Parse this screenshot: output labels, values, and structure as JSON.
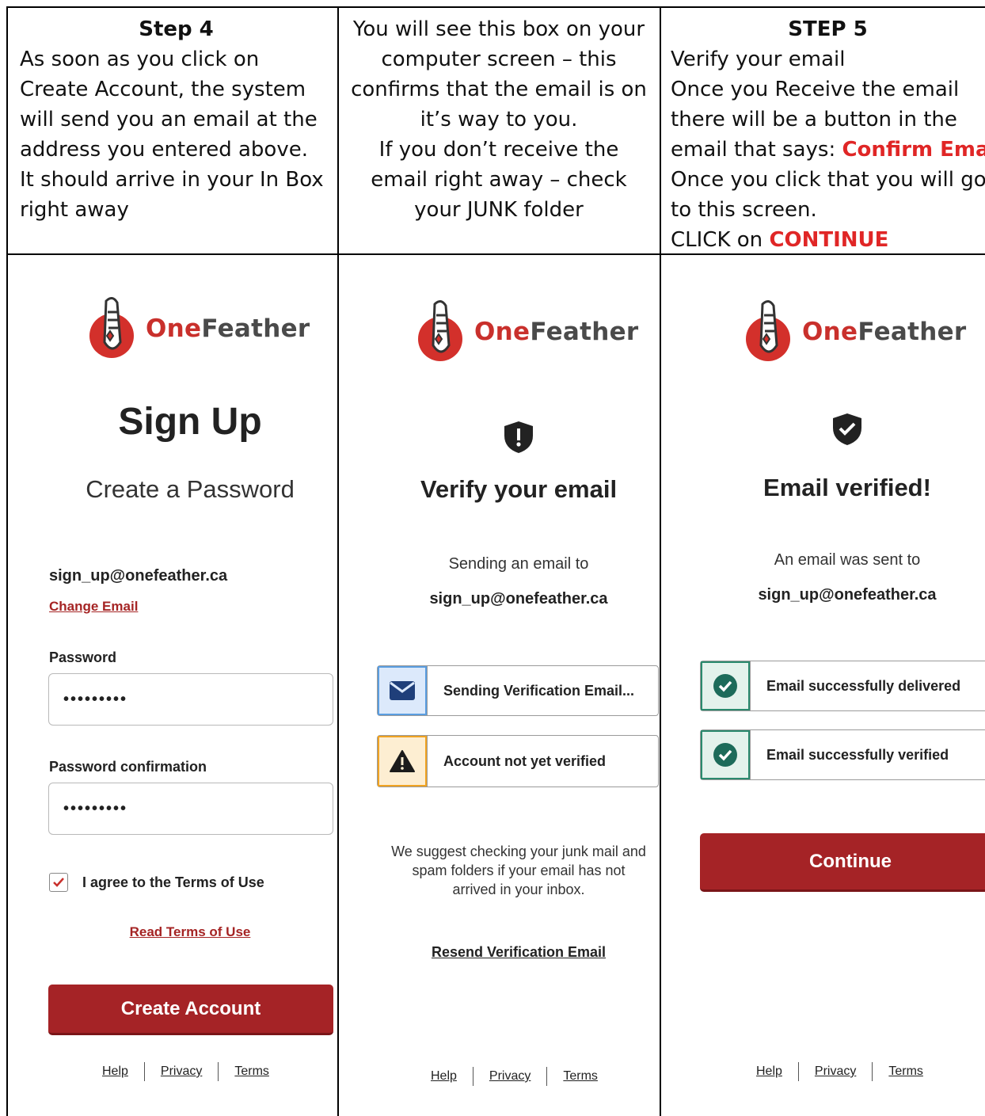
{
  "step4": {
    "heading": "Step 4",
    "lines": [
      "As soon as you click on",
      "Create Account,  the system",
      "will send you an email at the",
      "address you entered above.",
      "It should arrive in your In Box",
      "right away"
    ]
  },
  "middle_instructions": {
    "lines": [
      "You will see this box on your",
      "computer screen – this",
      "confirms that the email is on",
      "it’s way to you.",
      "If you don’t receive the",
      "email right away – check",
      "your JUNK folder"
    ]
  },
  "step5": {
    "heading": "STEP 5",
    "line1": "Verify your email",
    "line2": "Once you Receive the email",
    "line3": "there will be a button in the",
    "line4_prefix": "email that says: ",
    "line4_highlight": "Confirm Email",
    "line5": "Once you click that you will go",
    "line6": "to this screen.",
    "line7_prefix": "CLICK on ",
    "line7_highlight": "CONTINUE"
  },
  "logo": {
    "one": "One",
    "feather": "Feather"
  },
  "signup": {
    "title": "Sign Up",
    "subtitle": "Create a Password",
    "email": "sign_up@onefeather.ca",
    "change_email": "Change Email",
    "password_label": "Password",
    "password_value": "•••••••••",
    "confirm_label": "Password confirmation",
    "confirm_value": "•••••••••",
    "agree_label": "I agree to the Terms of Use",
    "read_terms": "Read Terms of Use",
    "create_button": "Create Account"
  },
  "verify": {
    "title": "Verify your email",
    "sending_to": "Sending an email to",
    "email": "sign_up@onefeather.ca",
    "status1": "Sending Verification Email...",
    "status2": "Account not yet verified",
    "suggest_lines": [
      "We suggest checking your junk mail and",
      "spam folders if your email has not",
      "arrived in your inbox."
    ],
    "resend": "Resend Verification Email"
  },
  "verified": {
    "title": "Email verified!",
    "sent_to": "An email was sent to",
    "email": "sign_up@onefeather.ca",
    "status1": "Email successfully delivered",
    "status2": "Email successfully verified",
    "continue_button": "Continue"
  },
  "footer": {
    "help": "Help",
    "privacy": "Privacy",
    "terms": "Terms"
  },
  "colors": {
    "brand_red": "#a52326",
    "highlight_red": "#e02626",
    "success_green": "#1d6b5a",
    "info_blue": "#1f3f7a",
    "warn_orange": "#f0a322"
  },
  "icons": [
    "logo-feather-icon",
    "shield-exclamation-icon",
    "shield-check-icon",
    "envelope-icon",
    "warning-icon",
    "check-circle-icon",
    "checkbox-check-icon"
  ]
}
